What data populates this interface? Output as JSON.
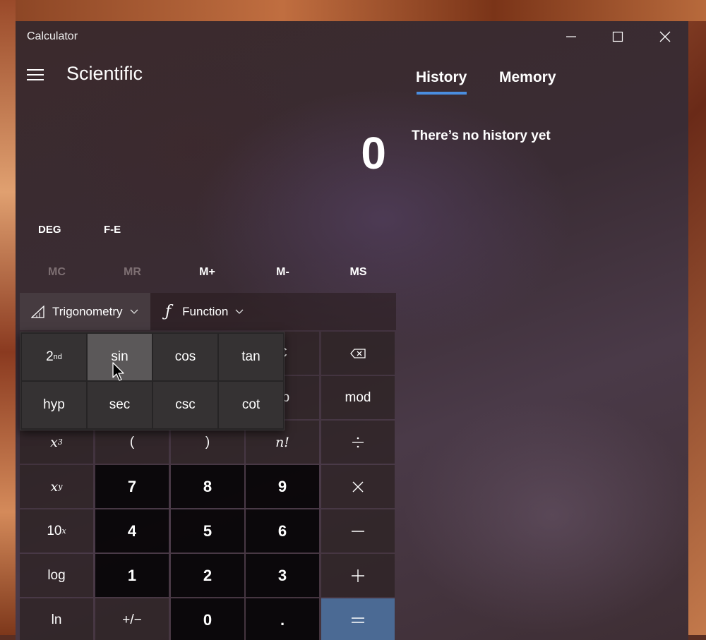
{
  "window": {
    "app_title": "Calculator",
    "minimize_icon": "minimize-icon",
    "maximize_icon": "maximize-icon",
    "close_icon": "close-icon"
  },
  "header": {
    "menu_icon": "hamburger-icon",
    "mode": "Scientific"
  },
  "display": {
    "value": "0"
  },
  "modes": {
    "angle": "DEG",
    "notation": "F-E"
  },
  "memory": {
    "mc": "MC",
    "mr": "MR",
    "m_plus": "M+",
    "m_minus": "M-",
    "ms": "MS"
  },
  "dropdowns": {
    "trigonometry": "Trigonometry",
    "function": "Function"
  },
  "trig_flyout": {
    "second": "2",
    "second_sup": "nd",
    "sin": "sin",
    "cos": "cos",
    "tan": "tan",
    "hyp": "hyp",
    "sec": "sec",
    "csc": "csc",
    "cot": "cot"
  },
  "keys": {
    "partial_c": "C",
    "partial_exp": "xp",
    "mod": "mod",
    "x3_base": "x",
    "x3_sup": "3",
    "open_paren": "(",
    "close_paren": ")",
    "factorial": "n!",
    "xy_base": "x",
    "xy_sup": "y",
    "ten_x_base": "10",
    "ten_x_sup": "x",
    "log": "log",
    "ln": "ln",
    "negate": "+/−",
    "decimal": ".",
    "digits": [
      "7",
      "8",
      "9",
      "4",
      "5",
      "6",
      "1",
      "2",
      "3",
      "0"
    ]
  },
  "side_panel": {
    "history_tab": "History",
    "memory_tab": "Memory",
    "empty_message": "There’s no history yet"
  },
  "colors": {
    "accent": "#4a8ee0",
    "equals_key": "#4b6a94"
  }
}
